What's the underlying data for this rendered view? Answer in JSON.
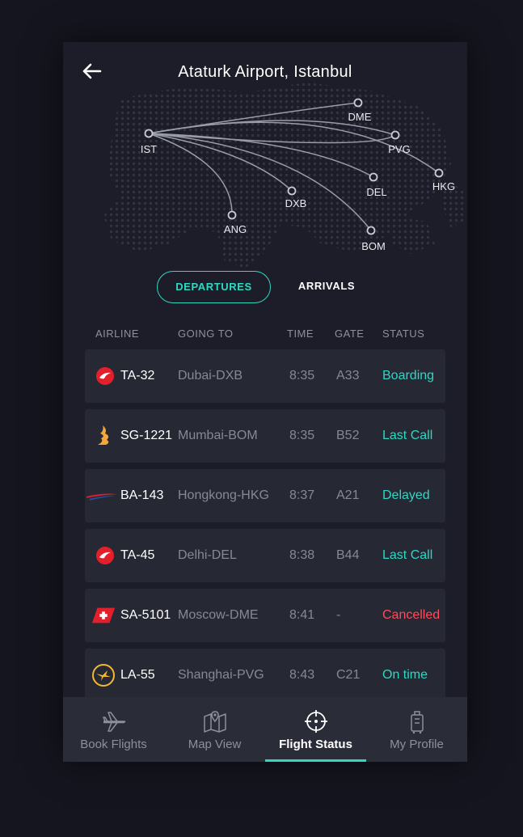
{
  "header": {
    "title": "Ataturk Airport, Istanbul"
  },
  "map": {
    "origin": "IST",
    "destinations": [
      "DME",
      "PVG",
      "HKG",
      "DEL",
      "DXB",
      "ANG",
      "BOM"
    ]
  },
  "tabs": {
    "departures": "DEPARTURES",
    "arrivals": "ARRIVALS",
    "active": "DEPARTURES"
  },
  "columns": {
    "airline": "AIRLINE",
    "going_to": "GOING TO",
    "time": "TIME",
    "gate": "GATE",
    "status": "STATUS"
  },
  "flights": [
    {
      "airline": "Turkish Airlines",
      "logo": "turkish-airlines-logo-icon",
      "code": "TA-32",
      "destination": "Dubai-DXB",
      "time": "8:35",
      "gate": "A33",
      "status": "Boarding",
      "status_color": "#2ed8c3"
    },
    {
      "airline": "Singapore Airlines",
      "logo": "singapore-airlines-logo-icon",
      "code": "SG-1221",
      "destination": "Mumbai-BOM",
      "time": "8:35",
      "gate": "B52",
      "status": "Last Call",
      "status_color": "#2ed8c3"
    },
    {
      "airline": "British Airways",
      "logo": "british-airways-logo-icon",
      "code": "BA-143",
      "destination": "Hongkong-HKG",
      "time": "8:37",
      "gate": "A21",
      "status": "Delayed",
      "status_color": "#2ed8c3"
    },
    {
      "airline": "Turkish Airlines",
      "logo": "turkish-airlines-logo-icon",
      "code": "TA-45",
      "destination": "Delhi-DEL",
      "time": "8:38",
      "gate": "B44",
      "status": "Last Call",
      "status_color": "#2ed8c3"
    },
    {
      "airline": "Swiss",
      "logo": "swiss-logo-icon",
      "code": "SA-5101",
      "destination": "Moscow-DME",
      "time": "8:41",
      "gate": "-",
      "status": "Cancelled",
      "status_color": "#ff4b5c"
    },
    {
      "airline": "Lufthansa",
      "logo": "lufthansa-logo-icon",
      "code": "LA-55",
      "destination": "Shanghai-PVG",
      "time": "8:43",
      "gate": "C21",
      "status": "On time",
      "status_color": "#2ed8c3"
    }
  ],
  "nav": {
    "items": [
      {
        "label": "Book Flights",
        "icon": "plane-icon"
      },
      {
        "label": "Map View",
        "icon": "map-icon"
      },
      {
        "label": "Flight Status",
        "icon": "crosshair-icon"
      },
      {
        "label": "My Profile",
        "icon": "luggage-icon"
      }
    ],
    "active": "Flight Status"
  },
  "colors": {
    "accent": "#2ed8c3",
    "danger": "#ff4b5c",
    "background": "#1c1d28",
    "card": "#262834"
  }
}
